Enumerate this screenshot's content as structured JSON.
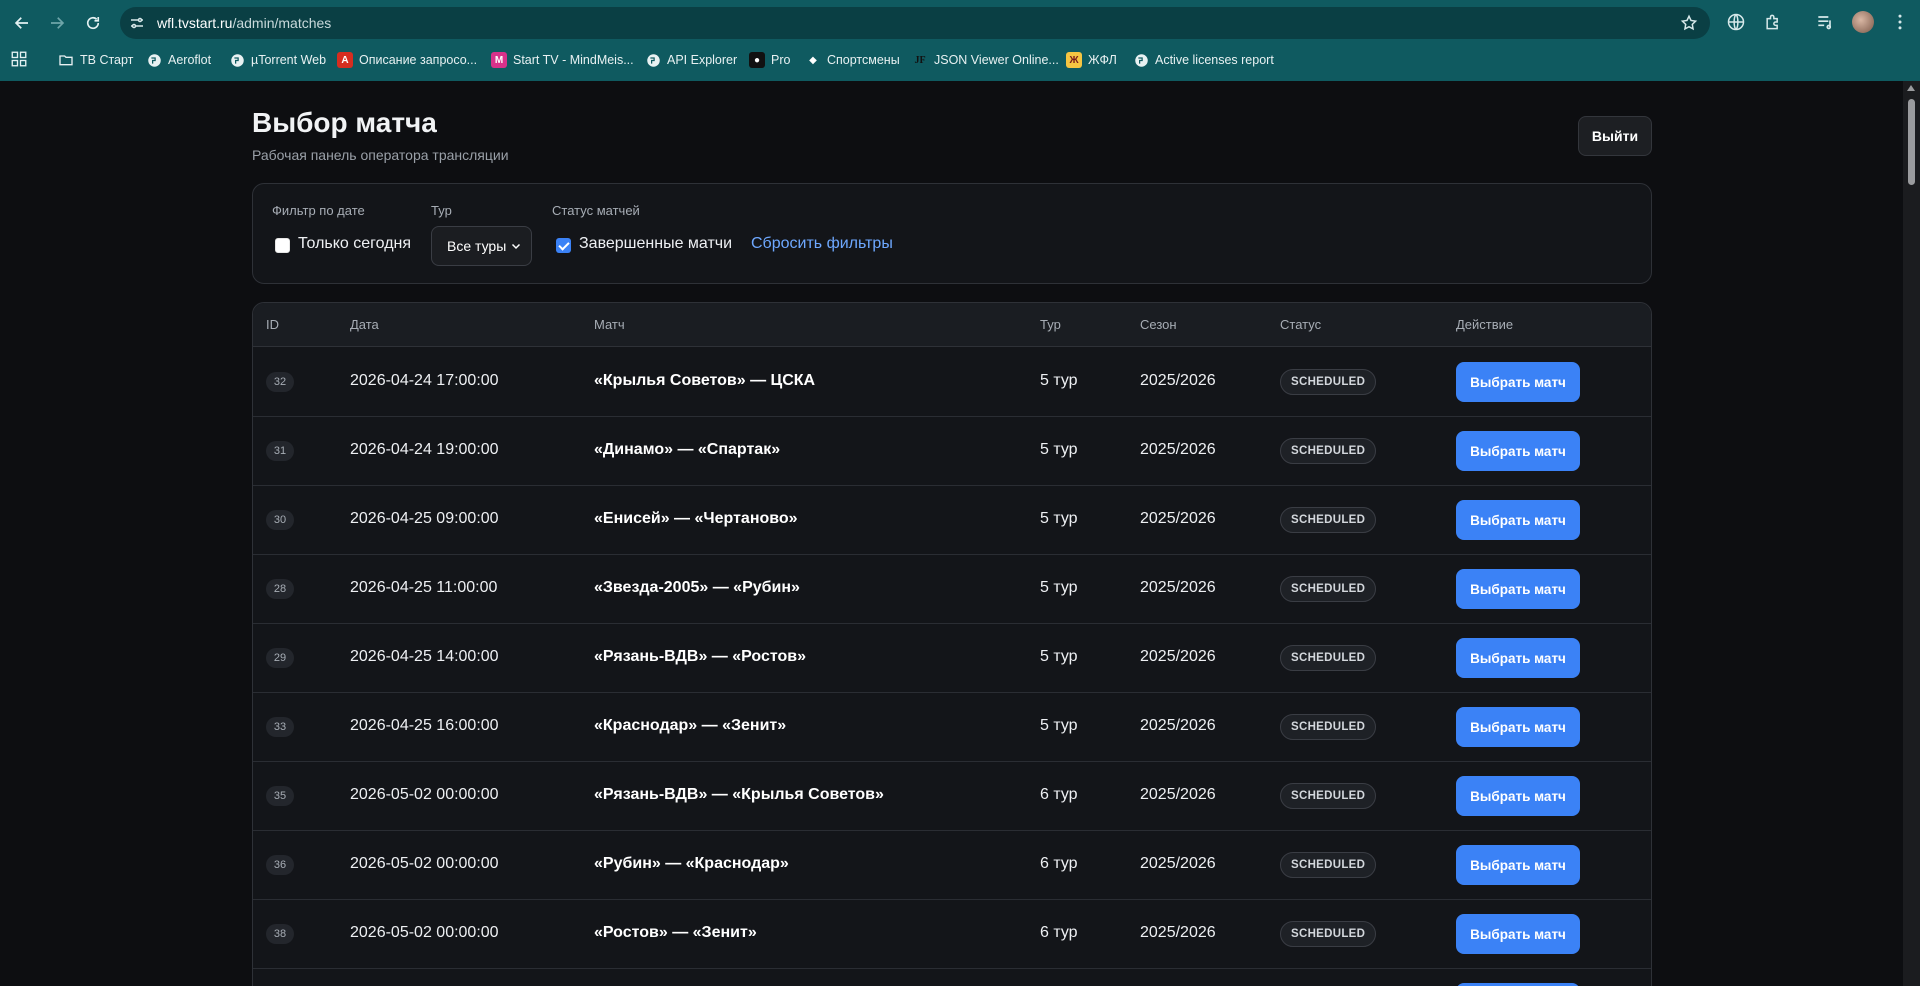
{
  "browser": {
    "url_host": "wfl.tvstart.ru",
    "url_path": "/admin/matches",
    "bookmarks": [
      {
        "label": "ТВ Старт",
        "icon": "folder-icon"
      },
      {
        "label": "Aeroflot",
        "icon": "globe-icon"
      },
      {
        "label": "µTorrent Web",
        "icon": "globe-icon"
      },
      {
        "label": "Описание запросо...",
        "icon": "pdf-icon"
      },
      {
        "label": "Start TV - MindMeis...",
        "icon": "mindmeister-icon"
      },
      {
        "label": "API Explorer",
        "icon": "globe-icon"
      },
      {
        "label": "Pro",
        "icon": "pro-icon"
      },
      {
        "label": "Спортсмены",
        "icon": "diamond-icon"
      },
      {
        "label": "JSON Viewer Online...",
        "icon": "json-icon"
      },
      {
        "label": "ЖФЛ",
        "icon": "zhfl-icon"
      },
      {
        "label": "Active licenses report",
        "icon": "globe-icon"
      }
    ]
  },
  "page": {
    "title": "Выбор матча",
    "subtitle": "Рабочая панель оператора трансляции",
    "logout_label": "Выйти"
  },
  "filters": {
    "date_label": "Фильтр по дате",
    "today_only_label": "Только сегодня",
    "today_only_checked": false,
    "tour_label": "Тур",
    "tour_selected": "Все туры",
    "status_label": "Статус матчей",
    "finished_label": "Завершенные матчи",
    "finished_checked": true,
    "reset_label": "Сбросить фильтры"
  },
  "table": {
    "columns": [
      "ID",
      "Дата",
      "Матч",
      "Тур",
      "Сезон",
      "Статус",
      "Действие"
    ],
    "action_label": "Выбрать матч",
    "rows": [
      {
        "id": "32",
        "date": "2026-04-24 17:00:00",
        "match": "«Крылья Советов» — ЦСКА",
        "tour": "5 тур",
        "season": "2025/2026",
        "status": "SCHEDULED"
      },
      {
        "id": "31",
        "date": "2026-04-24 19:00:00",
        "match": "«Динамо» — «Спартак»",
        "tour": "5 тур",
        "season": "2025/2026",
        "status": "SCHEDULED"
      },
      {
        "id": "30",
        "date": "2026-04-25 09:00:00",
        "match": "«Енисей» — «Чертаново»",
        "tour": "5 тур",
        "season": "2025/2026",
        "status": "SCHEDULED"
      },
      {
        "id": "28",
        "date": "2026-04-25 11:00:00",
        "match": "«Звезда-2005» — «Рубин»",
        "tour": "5 тур",
        "season": "2025/2026",
        "status": "SCHEDULED"
      },
      {
        "id": "29",
        "date": "2026-04-25 14:00:00",
        "match": "«Рязань-ВДВ» — «Ростов»",
        "tour": "5 тур",
        "season": "2025/2026",
        "status": "SCHEDULED"
      },
      {
        "id": "33",
        "date": "2026-04-25 16:00:00",
        "match": "«Краснодар» — «Зенит»",
        "tour": "5 тур",
        "season": "2025/2026",
        "status": "SCHEDULED"
      },
      {
        "id": "35",
        "date": "2026-05-02 00:00:00",
        "match": "«Рязань-ВДВ» — «Крылья Советов»",
        "tour": "6 тур",
        "season": "2025/2026",
        "status": "SCHEDULED"
      },
      {
        "id": "36",
        "date": "2026-05-02 00:00:00",
        "match": "«Рубин» — «Краснодар»",
        "tour": "6 тур",
        "season": "2025/2026",
        "status": "SCHEDULED"
      },
      {
        "id": "38",
        "date": "2026-05-02 00:00:00",
        "match": "«Ростов» — «Зенит»",
        "tour": "6 тур",
        "season": "2025/2026",
        "status": "SCHEDULED"
      }
    ]
  }
}
